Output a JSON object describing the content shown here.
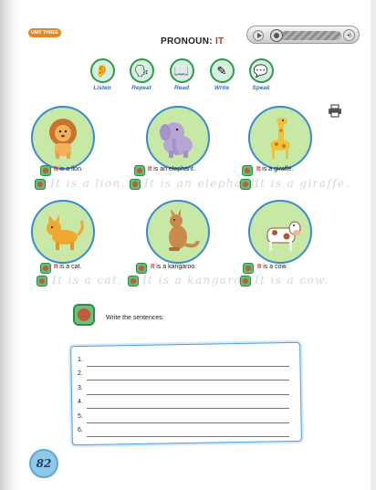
{
  "header": {
    "unit_badge": "UNIT THREE",
    "title_prefix": "PRONOUN:",
    "title_highlight": "IT"
  },
  "audio_player": {
    "play_icon": "play-icon",
    "volume_icon": "volume-icon",
    "progress": 0.0
  },
  "activities": [
    {
      "label": "Listen",
      "icon": "listen-icon"
    },
    {
      "label": "Repeat",
      "icon": "repeat-icon"
    },
    {
      "label": "Read",
      "icon": "read-icon"
    },
    {
      "label": "Write",
      "icon": "write-icon"
    },
    {
      "label": "Speak",
      "icon": "speak-icon"
    }
  ],
  "animals": [
    {
      "name": "lion",
      "pronoun": "It",
      "rest": "is a lion.",
      "trace": "It is a lion."
    },
    {
      "name": "elephant",
      "pronoun": "It",
      "rest": "is an elephant.",
      "trace": "It is an elephant."
    },
    {
      "name": "giraffe",
      "pronoun": "It",
      "rest": "is a giraffe.",
      "trace": "It is a giraffe."
    },
    {
      "name": "cat",
      "pronoun": "It",
      "rest": "is a cat.",
      "trace": "It is a cat."
    },
    {
      "name": "kangaroo",
      "pronoun": "It",
      "rest": "is a kangaroo.",
      "trace": "It is a kangaroo."
    },
    {
      "name": "cow",
      "pronoun": "It",
      "rest": "is a cow.",
      "trace": "It is a cow."
    }
  ],
  "exercise": {
    "instruction": "Write the sentences:",
    "lines": [
      "1.",
      "2.",
      "3.",
      "4.",
      "5.",
      "6."
    ]
  },
  "page_number": "82",
  "colors": {
    "accent_red": "#e2231a",
    "label_blue": "#2a73c9",
    "circle_green": "#c8e8a6",
    "circle_border": "#3a8ad0"
  }
}
